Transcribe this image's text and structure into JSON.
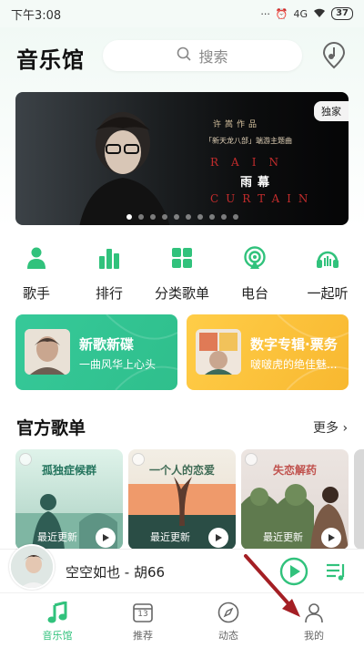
{
  "status_bar": {
    "time": "下午3:08",
    "signal": "4G",
    "battery": "37"
  },
  "header": {
    "title": "音乐馆",
    "search_label": "搜索"
  },
  "banner": {
    "badge": "独家",
    "line1": "许嵩作品",
    "line2": "「新天龙八部」端游主题曲",
    "line3": "RAIN",
    "line4": "雨幕",
    "line5": "CURTAIN",
    "slide_count": 10,
    "active_slide": 0
  },
  "categories": [
    {
      "label": "歌手",
      "icon": "singer-icon"
    },
    {
      "label": "排行",
      "icon": "chart-icon"
    },
    {
      "label": "分类歌单",
      "icon": "category-icon"
    },
    {
      "label": "电台",
      "icon": "radio-icon"
    },
    {
      "label": "一起听",
      "icon": "headphones-icon"
    }
  ],
  "promos": [
    {
      "title": "新歌新碟",
      "subtitle": "一曲风华上心头"
    },
    {
      "title": "数字专辑·票务",
      "subtitle": "啵啵虎的绝佳魅..."
    }
  ],
  "official": {
    "title": "官方歌单",
    "more": "更多"
  },
  "playlists": [
    {
      "title": "孤独症候群",
      "update": "最近更新"
    },
    {
      "title": "一个人的恋爱",
      "update": "最近更新"
    },
    {
      "title": "失恋解药",
      "update": "最近更新"
    }
  ],
  "player": {
    "song": "空空如也 - 胡66"
  },
  "tabs": [
    {
      "label": "音乐馆",
      "icon": "music-note-icon",
      "active": true
    },
    {
      "label": "推荐",
      "icon": "calendar-icon",
      "badge": "13"
    },
    {
      "label": "动态",
      "icon": "compass-icon"
    },
    {
      "label": "我的",
      "icon": "user-icon"
    }
  ],
  "colors": {
    "accent": "#31c27c",
    "promo_green": "#36c999",
    "promo_yellow": "#ffcd48",
    "annotation_arrow": "#a41f24"
  }
}
